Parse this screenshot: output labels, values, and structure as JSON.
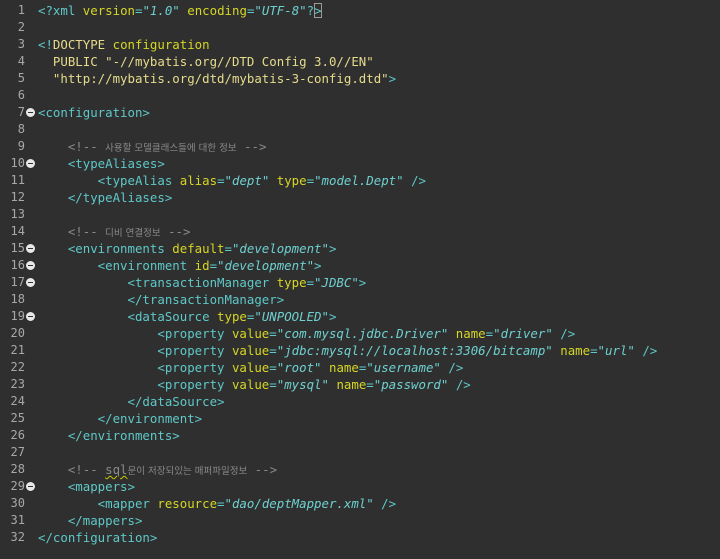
{
  "colors": {
    "background": "#2f2f2f",
    "line_number": "#a8a8a8",
    "tag": "#5fc8c8",
    "attribute": "#d6d626",
    "value": "#6fd0d0",
    "comment": "#8a8a8a",
    "doctype_string": "#e6dc8c"
  },
  "editor": {
    "lines": [
      {
        "num": "1",
        "fold": false,
        "tokens": [
          {
            "c": "t-tag",
            "t": "<?"
          },
          {
            "c": "t-tag",
            "t": "xml"
          },
          {
            "c": "t-tag",
            "t": " "
          },
          {
            "c": "t-attr",
            "t": "version"
          },
          {
            "c": "t-tag",
            "t": "="
          },
          {
            "c": "t-val",
            "t": "\"1.0\""
          },
          {
            "c": "t-tag",
            "t": " "
          },
          {
            "c": "t-attr",
            "t": "encoding"
          },
          {
            "c": "t-tag",
            "t": "="
          },
          {
            "c": "t-val",
            "t": "\"UTF-8\""
          },
          {
            "c": "t-tag",
            "t": "?"
          },
          {
            "c": "t-tag boxed",
            "t": ">"
          }
        ]
      },
      {
        "num": "2",
        "fold": false,
        "tokens": []
      },
      {
        "num": "3",
        "fold": false,
        "tokens": [
          {
            "c": "t-tag",
            "t": "<!"
          },
          {
            "c": "t-kw",
            "t": "DOCTYPE"
          },
          {
            "c": "t-tag",
            "t": " "
          },
          {
            "c": "t-attr",
            "t": "configuration"
          }
        ]
      },
      {
        "num": "4",
        "fold": false,
        "tokens": [
          {
            "c": "t-tag",
            "t": "  "
          },
          {
            "c": "t-kw",
            "t": "PUBLIC"
          },
          {
            "c": "t-tag",
            "t": " "
          },
          {
            "c": "t-str",
            "t": "\"-//mybatis.org//DTD Config 3.0//EN\""
          }
        ]
      },
      {
        "num": "5",
        "fold": false,
        "tokens": [
          {
            "c": "t-tag",
            "t": "  "
          },
          {
            "c": "t-str",
            "t": "\"http://mybatis.org/dtd/mybatis-3-config.dtd\""
          },
          {
            "c": "t-tag",
            "t": ">"
          }
        ]
      },
      {
        "num": "6",
        "fold": false,
        "tokens": []
      },
      {
        "num": "7",
        "fold": true,
        "tokens": [
          {
            "c": "t-tag",
            "t": "<configuration>"
          }
        ]
      },
      {
        "num": "8",
        "fold": false,
        "tokens": []
      },
      {
        "num": "9",
        "fold": false,
        "tokens": [
          {
            "c": "t-com",
            "t": "    <!-- "
          },
          {
            "c": "t-comk",
            "t": "사용할 모델클래스들에 대한 정보"
          },
          {
            "c": "t-com",
            "t": " -->"
          }
        ]
      },
      {
        "num": "10",
        "fold": true,
        "tokens": [
          {
            "c": "t-tag",
            "t": "    <typeAliases>"
          }
        ]
      },
      {
        "num": "11",
        "fold": false,
        "tokens": [
          {
            "c": "t-tag",
            "t": "        <typeAlias "
          },
          {
            "c": "t-attr",
            "t": "alias"
          },
          {
            "c": "t-tag",
            "t": "="
          },
          {
            "c": "t-val",
            "t": "\"dept\""
          },
          {
            "c": "t-tag",
            "t": " "
          },
          {
            "c": "t-attr",
            "t": "type"
          },
          {
            "c": "t-tag",
            "t": "="
          },
          {
            "c": "t-val",
            "t": "\"model.Dept\""
          },
          {
            "c": "t-tag",
            "t": " />"
          }
        ]
      },
      {
        "num": "12",
        "fold": false,
        "tokens": [
          {
            "c": "t-tag",
            "t": "    </typeAliases>"
          }
        ]
      },
      {
        "num": "13",
        "fold": false,
        "tokens": []
      },
      {
        "num": "14",
        "fold": false,
        "tokens": [
          {
            "c": "t-com",
            "t": "    <!-- "
          },
          {
            "c": "t-comk",
            "t": "디비 연결정보"
          },
          {
            "c": "t-com",
            "t": " -->"
          }
        ]
      },
      {
        "num": "15",
        "fold": true,
        "tokens": [
          {
            "c": "t-tag",
            "t": "    <environments "
          },
          {
            "c": "t-attr",
            "t": "default"
          },
          {
            "c": "t-tag",
            "t": "="
          },
          {
            "c": "t-val",
            "t": "\"development\""
          },
          {
            "c": "t-tag",
            "t": ">"
          }
        ]
      },
      {
        "num": "16",
        "fold": true,
        "tokens": [
          {
            "c": "t-tag",
            "t": "        <environment "
          },
          {
            "c": "t-attr",
            "t": "id"
          },
          {
            "c": "t-tag",
            "t": "="
          },
          {
            "c": "t-val",
            "t": "\"development\""
          },
          {
            "c": "t-tag",
            "t": ">"
          }
        ]
      },
      {
        "num": "17",
        "fold": true,
        "tokens": [
          {
            "c": "t-tag",
            "t": "            <transactionManager "
          },
          {
            "c": "t-attr",
            "t": "type"
          },
          {
            "c": "t-tag",
            "t": "="
          },
          {
            "c": "t-val",
            "t": "\"JDBC\""
          },
          {
            "c": "t-tag",
            "t": ">"
          }
        ]
      },
      {
        "num": "18",
        "fold": false,
        "tokens": [
          {
            "c": "t-tag",
            "t": "            </transactionManager>"
          }
        ]
      },
      {
        "num": "19",
        "fold": true,
        "tokens": [
          {
            "c": "t-tag",
            "t": "            <dataSource "
          },
          {
            "c": "t-attr",
            "t": "type"
          },
          {
            "c": "t-tag",
            "t": "="
          },
          {
            "c": "t-val",
            "t": "\"UNPOOLED\""
          },
          {
            "c": "t-tag",
            "t": ">"
          }
        ]
      },
      {
        "num": "20",
        "fold": false,
        "tokens": [
          {
            "c": "t-tag",
            "t": "                <property "
          },
          {
            "c": "t-attr",
            "t": "value"
          },
          {
            "c": "t-tag",
            "t": "="
          },
          {
            "c": "t-val",
            "t": "\"com.mysql.jdbc.Driver\""
          },
          {
            "c": "t-tag",
            "t": " "
          },
          {
            "c": "t-attr",
            "t": "name"
          },
          {
            "c": "t-tag",
            "t": "="
          },
          {
            "c": "t-val",
            "t": "\"driver\""
          },
          {
            "c": "t-tag",
            "t": " />"
          }
        ]
      },
      {
        "num": "21",
        "fold": false,
        "tokens": [
          {
            "c": "t-tag",
            "t": "                <property "
          },
          {
            "c": "t-attr",
            "t": "value"
          },
          {
            "c": "t-tag",
            "t": "="
          },
          {
            "c": "t-val",
            "t": "\"jdbc:mysql://localhost:3306/bitcamp\""
          },
          {
            "c": "t-tag",
            "t": " "
          },
          {
            "c": "t-attr",
            "t": "name"
          },
          {
            "c": "t-tag",
            "t": "="
          },
          {
            "c": "t-val",
            "t": "\"url\""
          },
          {
            "c": "t-tag",
            "t": " />"
          }
        ]
      },
      {
        "num": "22",
        "fold": false,
        "tokens": [
          {
            "c": "t-tag",
            "t": "                <property "
          },
          {
            "c": "t-attr",
            "t": "value"
          },
          {
            "c": "t-tag",
            "t": "="
          },
          {
            "c": "t-val",
            "t": "\"root\""
          },
          {
            "c": "t-tag",
            "t": " "
          },
          {
            "c": "t-attr",
            "t": "name"
          },
          {
            "c": "t-tag",
            "t": "="
          },
          {
            "c": "t-val",
            "t": "\"username\""
          },
          {
            "c": "t-tag",
            "t": " />"
          }
        ]
      },
      {
        "num": "23",
        "fold": false,
        "tokens": [
          {
            "c": "t-tag",
            "t": "                <property "
          },
          {
            "c": "t-attr",
            "t": "value"
          },
          {
            "c": "t-tag",
            "t": "="
          },
          {
            "c": "t-val",
            "t": "\"mysql\""
          },
          {
            "c": "t-tag",
            "t": " "
          },
          {
            "c": "t-attr",
            "t": "name"
          },
          {
            "c": "t-tag",
            "t": "="
          },
          {
            "c": "t-val",
            "t": "\"password\""
          },
          {
            "c": "t-tag",
            "t": " />"
          }
        ]
      },
      {
        "num": "24",
        "fold": false,
        "tokens": [
          {
            "c": "t-tag",
            "t": "            </dataSource>"
          }
        ]
      },
      {
        "num": "25",
        "fold": false,
        "tokens": [
          {
            "c": "t-tag",
            "t": "        </environment>"
          }
        ]
      },
      {
        "num": "26",
        "fold": false,
        "tokens": [
          {
            "c": "t-tag",
            "t": "    </environments>"
          }
        ]
      },
      {
        "num": "27",
        "fold": false,
        "tokens": []
      },
      {
        "num": "28",
        "fold": false,
        "tokens": [
          {
            "c": "t-com",
            "t": "    <!-- "
          },
          {
            "c": "t-com squiggle",
            "t": "sql"
          },
          {
            "c": "t-comk",
            "t": "문이 저장되있는 매퍼파일정보"
          },
          {
            "c": "t-com",
            "t": " -->"
          }
        ]
      },
      {
        "num": "29",
        "fold": true,
        "tokens": [
          {
            "c": "t-tag",
            "t": "    <mappers>"
          }
        ]
      },
      {
        "num": "30",
        "fold": false,
        "tokens": [
          {
            "c": "t-tag",
            "t": "        <mapper "
          },
          {
            "c": "t-attr",
            "t": "resource"
          },
          {
            "c": "t-tag",
            "t": "="
          },
          {
            "c": "t-val",
            "t": "\"dao/deptMapper.xml\""
          },
          {
            "c": "t-tag",
            "t": " />"
          }
        ]
      },
      {
        "num": "31",
        "fold": false,
        "tokens": [
          {
            "c": "t-tag",
            "t": "    </mappers>"
          }
        ]
      },
      {
        "num": "32",
        "fold": false,
        "tokens": [
          {
            "c": "t-tag",
            "t": "</configuration>"
          }
        ]
      }
    ]
  }
}
